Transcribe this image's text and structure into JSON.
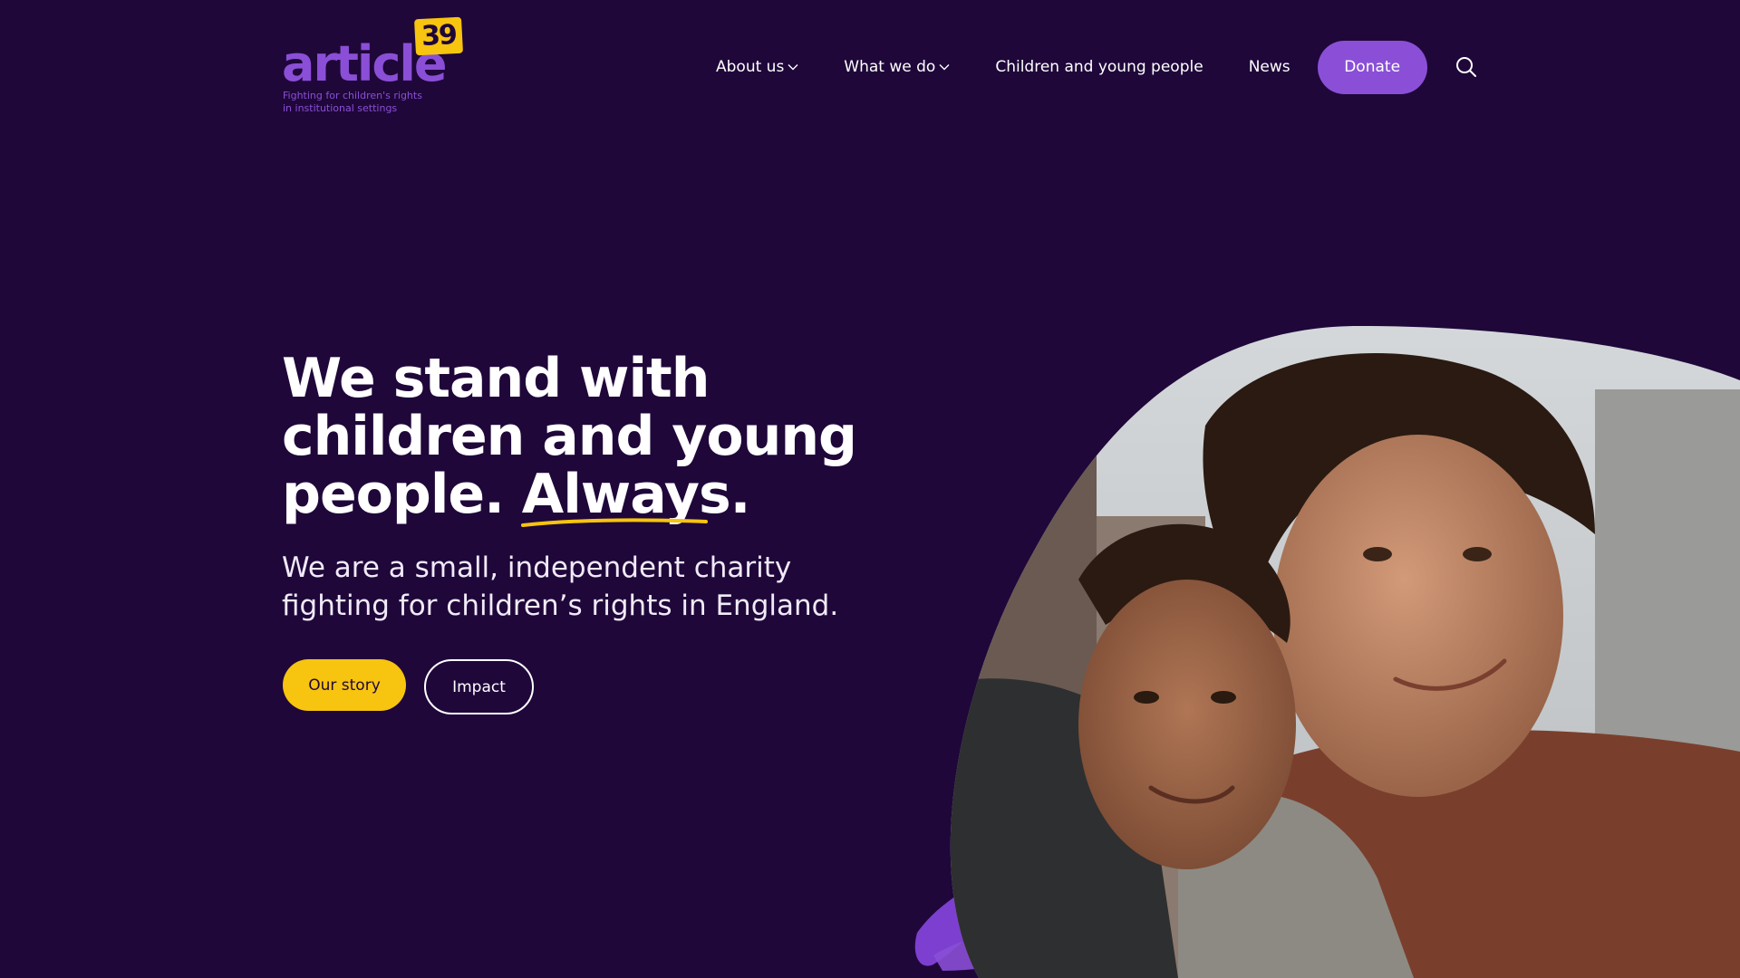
{
  "header": {
    "logo": {
      "wordmark": "article",
      "badge": "39",
      "tagline": "Fighting for children's rights\nin institutional settings"
    },
    "nav": {
      "about": "About us",
      "what_we_do": "What we do",
      "children": "Children and young people",
      "news": "News",
      "donate": "Donate"
    },
    "icons": {
      "search": "search-icon",
      "chevron": "chevron-down-icon"
    }
  },
  "hero": {
    "title_before": "We stand with children and young people. ",
    "title_emphasis": "Always",
    "title_after": ".",
    "subtitle": "We are a small, independent charity fighting for children’s rights in England.",
    "buttons": {
      "primary": "Our story",
      "secondary": "Impact"
    }
  },
  "colors": {
    "background": "#1f073a",
    "brand_purple": "#8a4fd6",
    "accent_yellow": "#f7c40f",
    "text": "#ffffff"
  }
}
